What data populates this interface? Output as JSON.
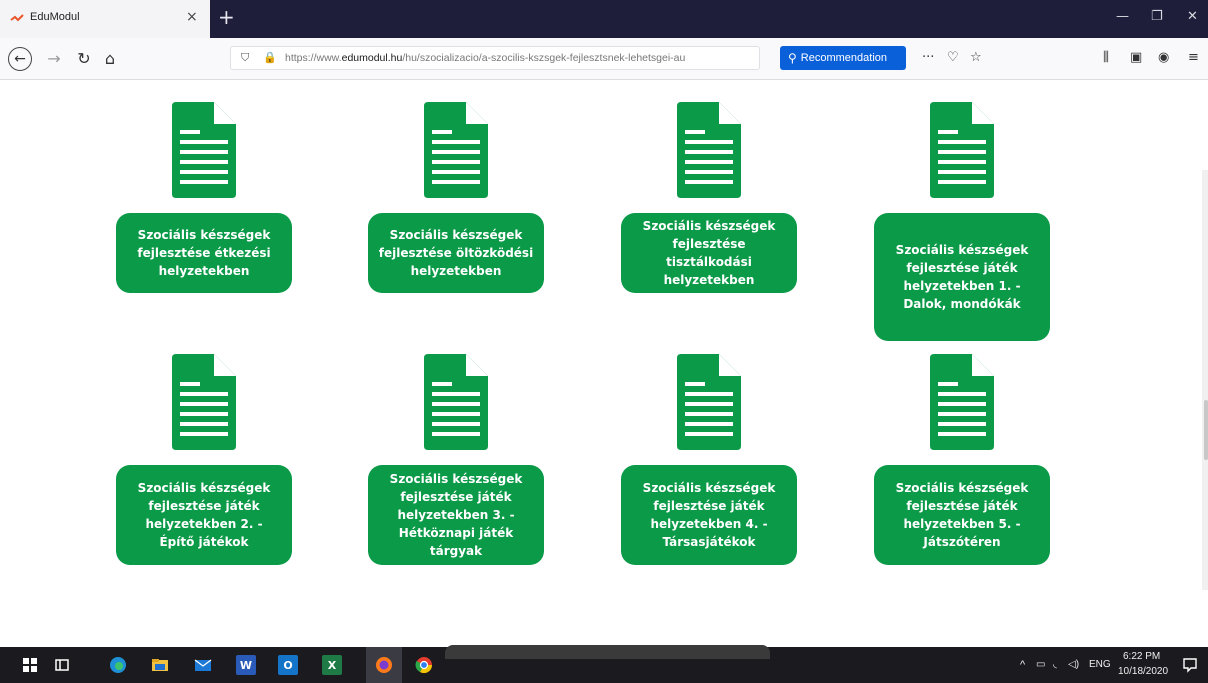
{
  "browser": {
    "tab_title": "EduModul",
    "tab_close": "×",
    "new_tab": "+",
    "url_prefix": "https://www.",
    "url_host": "edumodul.hu",
    "url_path": "/hu/szocializacio/a-szocilis-kszsgek-fejlesztsnek-lehetsgei-au",
    "recommendation_label": "Recommendation",
    "more_label": "···",
    "icons": [
      "back-icon",
      "forward-icon",
      "reload-icon",
      "home-icon",
      "shield-icon",
      "lock-icon",
      "pocket-icon",
      "star-icon",
      "library-icon",
      "sidebar-icon",
      "account-icon",
      "menu-icon"
    ]
  },
  "cards": [
    {
      "label": "Szociális készségek fejlesztése étkezési helyzetekben"
    },
    {
      "label": "Szociális készségek fejlesztése öltözködési helyzetekben"
    },
    {
      "label": "Szociális készségek fejlesztése tisztálkodási helyzetekben"
    },
    {
      "label": "Szociális készségek fejlesztése játék helyzetekben 1. - Dalok, mondókák"
    },
    {
      "label": "Szociális készségek fejlesztése játék helyzetekben 2. - Építő játékok"
    },
    {
      "label": "Szociális készségek fejlesztése játék helyzetekben 3. - Hétköznapi játék tárgyak"
    },
    {
      "label": "Szociális készségek fejlesztése játék helyzetekben 4. - Társasjátékok"
    },
    {
      "label": "Szociális készségek fejlesztése játék helyzetekben 5. - Játszótéren"
    }
  ],
  "taskbar": {
    "apps": [
      "windows-start-icon",
      "task-view-icon",
      "edge-icon",
      "file-explorer-icon",
      "mail-icon",
      "word-icon",
      "outlook-icon",
      "excel-icon",
      "firefox-icon",
      "chrome-icon"
    ],
    "word_label": "W",
    "outlook_label": "O",
    "excel_label": "X",
    "language": "ENG",
    "time": "6:22 PM",
    "date": "10/18/2020"
  },
  "colors": {
    "accent_green": "#0a9a48",
    "recommend_blue": "#0a60d8",
    "titlebar": "#1f1e3a"
  }
}
